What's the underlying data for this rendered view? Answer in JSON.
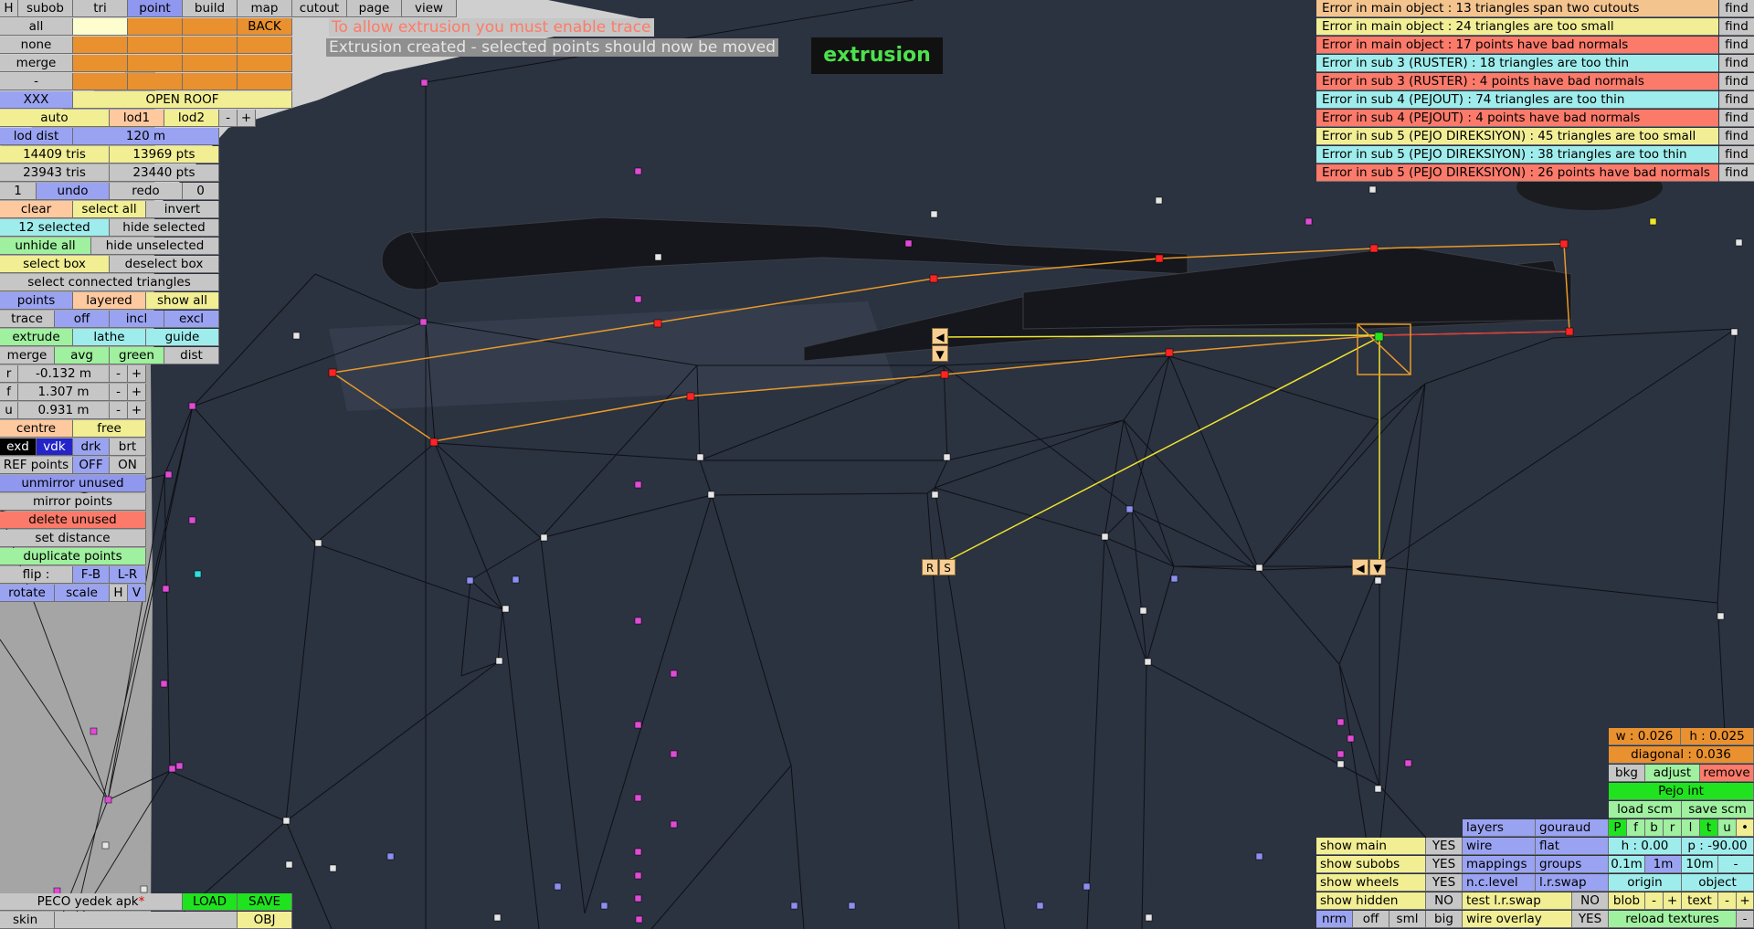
{
  "menu": {
    "h": "H",
    "subob": "subob",
    "tri": "tri",
    "point": "point",
    "build": "build",
    "map": "map",
    "cutout": "cutout",
    "page": "page",
    "view": "view"
  },
  "left": {
    "all": "all",
    "none": "none",
    "merge": "merge",
    "dash": "-",
    "back": "BACK",
    "xxx": "XXX",
    "open_roof": "OPEN ROOF",
    "auto": "auto",
    "lod1": "lod1",
    "lod2": "lod2",
    "minus": "-",
    "plus": "+",
    "lod_dist": "lod dist",
    "lod_dist_val": "120 m",
    "tris1": "14409 tris",
    "pts1": "13969 pts",
    "tris2": "23943 tris",
    "pts2": "23440 pts",
    "undo_count": "1",
    "undo": "undo",
    "redo": "redo",
    "redo_count": "0",
    "clear": "clear",
    "select_all": "select all",
    "invert": "invert",
    "selected": "12 selected",
    "hide_selected": "hide selected",
    "unhide_all": "unhide all",
    "hide_unselected": "hide unselected",
    "select_box": "select box",
    "deselect_box": "deselect box",
    "select_connected": "select connected triangles",
    "points": "points",
    "layered": "layered",
    "show_all": "show all",
    "trace": "trace",
    "off": "off",
    "incl": "incl",
    "excl": "excl",
    "extrude": "extrude",
    "lathe": "lathe",
    "guide": "guide",
    "merge2": "merge",
    "avg": "avg",
    "green": "green",
    "dist": "dist",
    "r": "r",
    "r_val": "-0.132 m",
    "f": "f",
    "f_val": "1.307 m",
    "u": "u",
    "u_val": "0.931 m",
    "centre": "centre",
    "free": "free",
    "exd": "exd",
    "vdk": "vdk",
    "drk": "drk",
    "brt": "brt",
    "ref_points": "REF points",
    "ref_off": "OFF",
    "ref_on": "ON",
    "unmirror": "unmirror unused",
    "mirror": "mirror points",
    "delete_unused": "delete unused",
    "set_distance": "set distance",
    "duplicate": "duplicate points",
    "flip": "flip :",
    "fb": "F-B",
    "lr": "L-R",
    "rotate": "rotate",
    "scale": "scale",
    "hh": "H",
    "vv": "V",
    "file": "PECO yedek apk",
    "load": "LOAD",
    "save": "SAVE",
    "skin": "skin",
    "obj": "OBJ"
  },
  "messages": {
    "warn": "To allow extrusion you must enable trace",
    "info": "Extrusion created - selected points should now be moved",
    "badge": "extrusion"
  },
  "errors": [
    {
      "text": "Error in main object : 13 triangles span two cutouts",
      "color": "#f4c48f"
    },
    {
      "text": "Error in main object : 24 triangles are too small",
      "color": "#f2ee96"
    },
    {
      "text": "Error in main object : 17 points have bad normals",
      "color": "#fb7a6a"
    },
    {
      "text": "Error in sub 3 (RUSTER) : 18 triangles are too thin",
      "color": "#9fecec"
    },
    {
      "text": "Error in sub 3 (RUSTER) : 4 points have bad normals",
      "color": "#fb7a6a"
    },
    {
      "text": "Error in sub 4 (PEJOUT) : 74 triangles are too thin",
      "color": "#9fecec"
    },
    {
      "text": "Error in sub 4 (PEJOUT) : 4 points have bad normals",
      "color": "#fb7a6a"
    },
    {
      "text": "Error in sub 5 (PEJO DIREKSIYON) : 45 triangles are too small",
      "color": "#f2ee96"
    },
    {
      "text": "Error in sub 5 (PEJO DIREKSIYON) : 38 triangles are too thin",
      "color": "#9fecec"
    },
    {
      "text": "Error in sub 5 (PEJO DIREKSIYON) : 26 points have bad normals",
      "color": "#fb7a6a"
    }
  ],
  "find": "find",
  "tools": {
    "r": "R",
    "s": "S",
    "left": "◀",
    "down": "▼"
  },
  "right": {
    "w": "w : 0.026",
    "h": "h : 0.025",
    "diagonal": "diagonal : 0.036",
    "bkg": "bkg",
    "adjust": "adjust",
    "remove": "remove",
    "pejo": "Pejo int",
    "load_scm": "load scm",
    "save_scm": "save scm",
    "P": "P",
    "f": "f",
    "b": "b",
    "r": "r",
    "l": "l",
    "t": "t",
    "u": "u",
    "dot": "•",
    "h0": "h : 0.00",
    "p90": "p : -90.00",
    "m01": "0.1m",
    "m1": "1m",
    "m10": "10m",
    "dash": "-",
    "origin": "origin",
    "object": "object",
    "blob": "blob",
    "minus": "-",
    "plus": "+",
    "text": "text",
    "reload": "reload textures"
  },
  "bottom": {
    "show_main": "show main",
    "show_subobs": "show subobs",
    "show_wheels": "show wheels",
    "show_hidden": "show hidden",
    "yes": "YES",
    "no": "NO",
    "layers": "layers",
    "gouraud": "gouraud",
    "wire": "wire",
    "flat": "flat",
    "mappings": "mappings",
    "groups": "groups",
    "nclevel": "n.c.level",
    "lrswap": "l.r.swap",
    "test_lr": "test l.r.swap",
    "wire_overlay": "wire overlay",
    "nrm": "nrm",
    "off": "off",
    "sml": "sml",
    "big": "big"
  }
}
